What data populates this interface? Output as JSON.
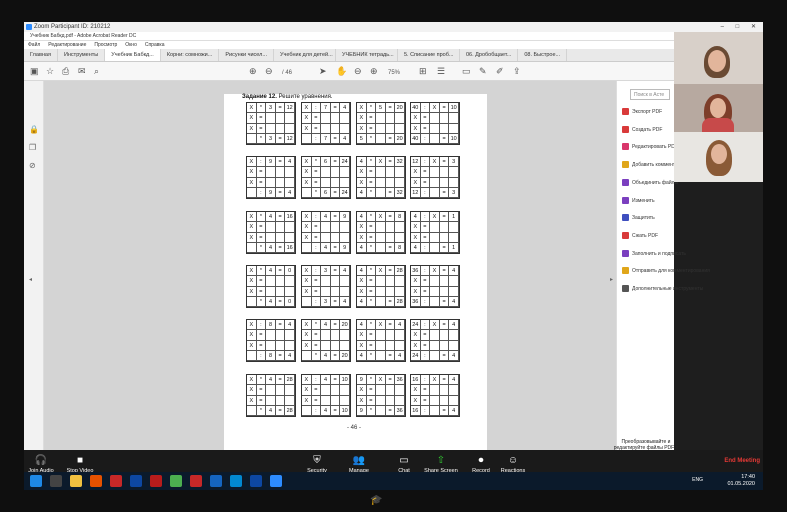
{
  "zoom": {
    "title": "Zoom Participant ID: 210212",
    "window_buttons": "– □ ✕"
  },
  "acrobat": {
    "title": "Учебник Бабкд.pdf - Adobe Acrobat Reader DC",
    "menu": [
      "Файл",
      "Редактирование",
      "Просмотр",
      "Окно",
      "Справка"
    ],
    "tabs": [
      "Главная",
      "Инструменты",
      "Учебник Бабкд...",
      "Корни: сомножи...",
      "Рисунки чисел...",
      "Учебник для детей...",
      "УЧЕБНИК тетрадь...",
      "5. Списание проб...",
      "06. Дробобщает...",
      "08. Быстрое..."
    ],
    "page_indicator": "/ 46",
    "zoom_level": "75%"
  },
  "page": {
    "task_bold": "Задание 12.",
    "task_text": " Решите уравнения.",
    "page_number": "- 46 -",
    "boxes": [
      [
        [
          "X",
          "*",
          "3",
          "=",
          "12"
        ],
        [
          "X",
          "=",
          "",
          "",
          ""
        ],
        [
          "X",
          "=",
          "",
          "",
          ""
        ],
        [
          "",
          "*",
          "3",
          "=",
          "12"
        ]
      ],
      [
        [
          "X",
          ":",
          "7",
          "=",
          "4"
        ],
        [
          "X",
          "=",
          "",
          "",
          ""
        ],
        [
          "X",
          "=",
          "",
          "",
          ""
        ],
        [
          "",
          ":",
          "7",
          "=",
          "4"
        ]
      ],
      [
        [
          "X",
          "*",
          "5",
          "=",
          "20"
        ],
        [
          "X",
          "=",
          "",
          "",
          ""
        ],
        [
          "X",
          "=",
          "",
          "",
          ""
        ],
        [
          "5",
          "*",
          "",
          "=",
          "20"
        ]
      ],
      [
        [
          "40",
          ":",
          "X",
          "=",
          "10"
        ],
        [
          "X",
          "=",
          "",
          "",
          ""
        ],
        [
          "X",
          "=",
          "",
          "",
          ""
        ],
        [
          "40",
          ":",
          "",
          "=",
          "10"
        ]
      ],
      [
        [
          "X",
          ":",
          "9",
          "=",
          "4"
        ],
        [
          "X",
          "=",
          "",
          "",
          ""
        ],
        [
          "X",
          "=",
          "",
          "",
          ""
        ],
        [
          "",
          ":",
          "9",
          "=",
          "4"
        ]
      ],
      [
        [
          "X",
          "*",
          "6",
          "=",
          "24"
        ],
        [
          "X",
          "=",
          "",
          "",
          ""
        ],
        [
          "X",
          "=",
          "",
          "",
          ""
        ],
        [
          "",
          "*",
          "6",
          "=",
          "24"
        ]
      ],
      [
        [
          "4",
          "*",
          "X",
          "=",
          "32"
        ],
        [
          "X",
          "=",
          "",
          "",
          ""
        ],
        [
          "X",
          "=",
          "",
          "",
          ""
        ],
        [
          "4",
          "*",
          "",
          "=",
          "32"
        ]
      ],
      [
        [
          "12",
          ":",
          "X",
          "=",
          "3"
        ],
        [
          "X",
          "=",
          "",
          "",
          ""
        ],
        [
          "X",
          "=",
          "",
          "",
          ""
        ],
        [
          "12",
          ":",
          "",
          "=",
          "3"
        ]
      ],
      [
        [
          "X",
          "*",
          "4",
          "=",
          "16"
        ],
        [
          "X",
          "=",
          "",
          "",
          ""
        ],
        [
          "X",
          "=",
          "",
          "",
          ""
        ],
        [
          "",
          "*",
          "4",
          "=",
          "16"
        ]
      ],
      [
        [
          "X",
          ":",
          "4",
          "=",
          "9"
        ],
        [
          "X",
          "=",
          "",
          "",
          ""
        ],
        [
          "X",
          "=",
          "",
          "",
          ""
        ],
        [
          "",
          ":",
          "4",
          "=",
          "9"
        ]
      ],
      [
        [
          "4",
          "*",
          "X",
          "=",
          "8"
        ],
        [
          "X",
          "=",
          "",
          "",
          ""
        ],
        [
          "X",
          "=",
          "",
          "",
          ""
        ],
        [
          "4",
          "*",
          "",
          "=",
          "8"
        ]
      ],
      [
        [
          "4",
          ":",
          "X",
          "=",
          "1"
        ],
        [
          "X",
          "=",
          "",
          "",
          ""
        ],
        [
          "X",
          "=",
          "",
          "",
          ""
        ],
        [
          "4",
          ":",
          "",
          "=",
          "1"
        ]
      ],
      [
        [
          "X",
          "*",
          "4",
          "=",
          "0"
        ],
        [
          "X",
          "=",
          "",
          "",
          ""
        ],
        [
          "X",
          "=",
          "",
          "",
          ""
        ],
        [
          "",
          "*",
          "4",
          "=",
          "0"
        ]
      ],
      [
        [
          "X",
          ":",
          "3",
          "=",
          "4"
        ],
        [
          "X",
          "=",
          "",
          "",
          ""
        ],
        [
          "X",
          "=",
          "",
          "",
          ""
        ],
        [
          "",
          ":",
          "3",
          "=",
          "4"
        ]
      ],
      [
        [
          "4",
          "*",
          "X",
          "=",
          "28"
        ],
        [
          "X",
          "=",
          "",
          "",
          ""
        ],
        [
          "X",
          "=",
          "",
          "",
          ""
        ],
        [
          "4",
          "*",
          "",
          "=",
          "28"
        ]
      ],
      [
        [
          "36",
          ":",
          "X",
          "=",
          "4"
        ],
        [
          "X",
          "=",
          "",
          "",
          ""
        ],
        [
          "X",
          "=",
          "",
          "",
          ""
        ],
        [
          "36",
          ":",
          "",
          "=",
          "4"
        ]
      ],
      [
        [
          "X",
          ":",
          "8",
          "=",
          "4"
        ],
        [
          "X",
          "=",
          "",
          "",
          ""
        ],
        [
          "X",
          "=",
          "",
          "",
          ""
        ],
        [
          "",
          ":",
          "8",
          "=",
          "4"
        ]
      ],
      [
        [
          "X",
          "*",
          "4",
          "=",
          "20"
        ],
        [
          "X",
          "=",
          "",
          "",
          ""
        ],
        [
          "X",
          "=",
          "",
          "",
          ""
        ],
        [
          "",
          "*",
          "4",
          "=",
          "20"
        ]
      ],
      [
        [
          "4",
          "*",
          "X",
          "=",
          "4"
        ],
        [
          "X",
          "=",
          "",
          "",
          ""
        ],
        [
          "X",
          "=",
          "",
          "",
          ""
        ],
        [
          "4",
          "*",
          "",
          "=",
          "4"
        ]
      ],
      [
        [
          "24",
          ":",
          "X",
          "=",
          "4"
        ],
        [
          "X",
          "=",
          "",
          "",
          ""
        ],
        [
          "X",
          "=",
          "",
          "",
          ""
        ],
        [
          "24",
          ":",
          "",
          "=",
          "4"
        ]
      ],
      [
        [
          "X",
          "*",
          "4",
          "=",
          "28"
        ],
        [
          "X",
          "=",
          "",
          "",
          ""
        ],
        [
          "X",
          "=",
          "",
          "",
          ""
        ],
        [
          "",
          "*",
          "4",
          "=",
          "28"
        ]
      ],
      [
        [
          "X",
          ":",
          "4",
          "=",
          "10"
        ],
        [
          "X",
          "=",
          "",
          "",
          ""
        ],
        [
          "X",
          "=",
          "",
          "",
          ""
        ],
        [
          "",
          ":",
          "4",
          "=",
          "10"
        ]
      ],
      [
        [
          "9",
          "*",
          "X",
          "=",
          "36"
        ],
        [
          "X",
          "=",
          "",
          "",
          ""
        ],
        [
          "X",
          "=",
          "",
          "",
          ""
        ],
        [
          "9",
          "*",
          "",
          "=",
          "36"
        ]
      ],
      [
        [
          "16",
          ":",
          "X",
          "=",
          "4"
        ],
        [
          "X",
          "=",
          "",
          "",
          ""
        ],
        [
          "X",
          "=",
          "",
          "",
          ""
        ],
        [
          "16",
          ":",
          "",
          "=",
          "4"
        ]
      ]
    ]
  },
  "right_panel": {
    "search_placeholder": "Поиск в Асте",
    "items": [
      {
        "label": "Экспорт PDF",
        "color": "#d93a3a"
      },
      {
        "label": "Создать PDF",
        "color": "#d93a3a"
      },
      {
        "label": "Редактировать PDF",
        "color": "#d9366b"
      },
      {
        "label": "Добавить комментарий",
        "color": "#e0a61a"
      },
      {
        "label": "Объединить файлы",
        "color": "#7b3fbf"
      },
      {
        "label": "Изменить",
        "color": "#7b3fbf"
      },
      {
        "label": "Защитить",
        "color": "#3f4fbf"
      },
      {
        "label": "Сжать PDF",
        "color": "#d93a3a"
      },
      {
        "label": "Заполнить и подписать",
        "color": "#7b3fbf"
      },
      {
        "label": "Отправить для комментирования",
        "color": "#e0a61a"
      },
      {
        "label": "Дополнительные инструменты",
        "color": "#555555"
      }
    ],
    "promo": "Преобразовывайте и редактируйте файлы PDF в Acrobat Pro DC",
    "promo_link": "Бесплатная пробная версия"
  },
  "zoombar": {
    "buttons": [
      {
        "label": "Join Audio",
        "icon": "headphones-icon"
      },
      {
        "label": "Stop Video",
        "icon": "camera-icon"
      },
      {
        "label": "Security",
        "icon": "shield-icon"
      },
      {
        "label": "Manage Participants",
        "icon": "people-icon"
      },
      {
        "label": "Chat",
        "icon": "chat-icon"
      },
      {
        "label": "Share Screen",
        "icon": "share-icon"
      },
      {
        "label": "Record",
        "icon": "record-icon"
      },
      {
        "label": "Reactions",
        "icon": "smile-icon"
      }
    ],
    "end_label": "End Meeting"
  },
  "taskbar": {
    "time": "17:40",
    "date": "01.05.2020",
    "lang": "ENG"
  }
}
